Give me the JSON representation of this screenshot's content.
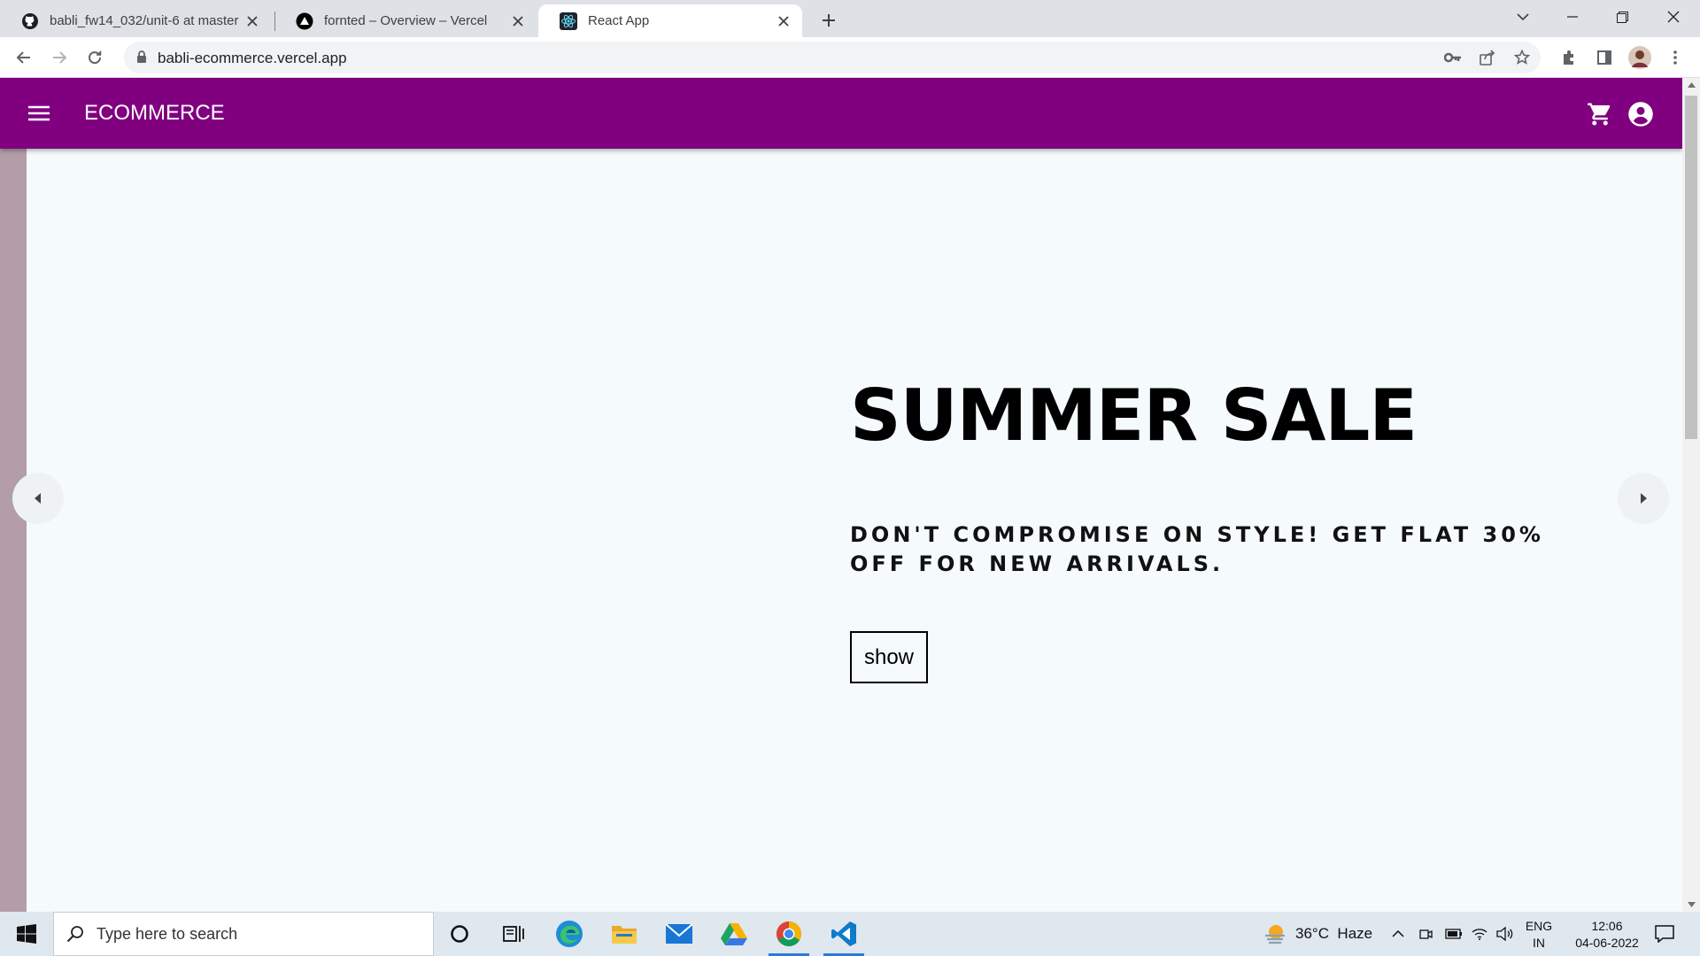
{
  "browser": {
    "tabs": [
      {
        "title": "babli_fw14_032/unit-6 at master",
        "favicon": "github-icon",
        "active": false
      },
      {
        "title": "fornted – Overview – Vercel",
        "favicon": "vercel-icon",
        "active": false
      },
      {
        "title": "React App",
        "favicon": "react-icon",
        "active": true
      }
    ],
    "address": "babli-ecommerce.vercel.app"
  },
  "app": {
    "brand": "ECOMMERCE",
    "theme_color": "#800080",
    "slide": {
      "headline": "SUMMER SALE",
      "subtext": "DON'T COMPROMISE ON STYLE! GET FLAT 30% OFF FOR NEW ARRIVALS.",
      "button_label": "show"
    }
  },
  "taskbar": {
    "search_placeholder": "Type here to search",
    "weather": "36°C  Haze",
    "lang_line1": "ENG",
    "lang_line2": "IN",
    "time": "12:06",
    "date": "04-06-2022",
    "pinned_apps": [
      "cortana-icon",
      "task-view-icon",
      "edge-icon",
      "file-explorer-icon",
      "mail-icon",
      "google-drive-icon",
      "chrome-icon",
      "vscode-icon"
    ]
  }
}
